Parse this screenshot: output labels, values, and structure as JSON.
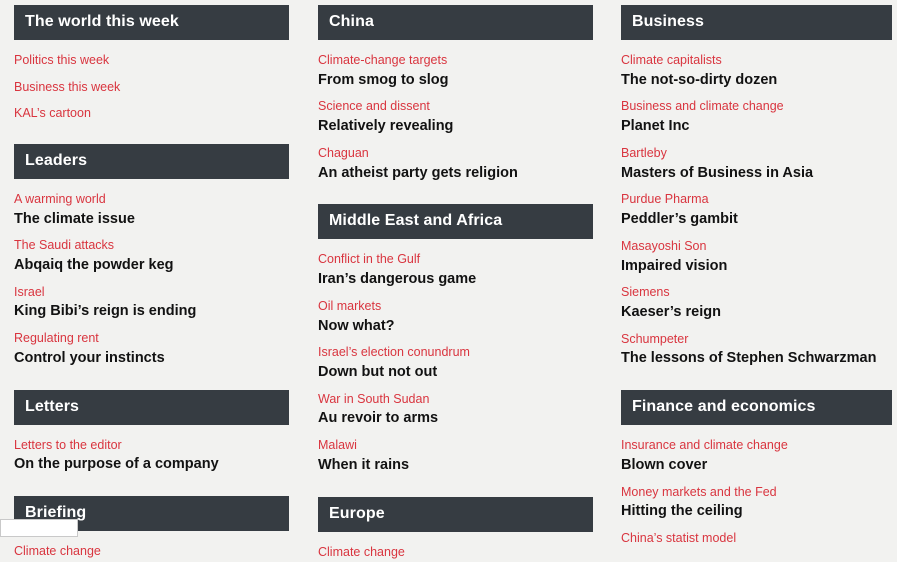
{
  "page": {
    "background_color": "#f2f2f0",
    "header_bar_color": "#363c42",
    "flytitle_color": "#d9353f",
    "headline_color": "#121212"
  },
  "columns": [
    {
      "name": "column-left",
      "sections": [
        {
          "title": "The world this week",
          "style": "links-only",
          "articles": [
            {
              "flytitle": "Politics this week",
              "headline": ""
            },
            {
              "flytitle": "Business this week",
              "headline": ""
            },
            {
              "flytitle": "KAL’s cartoon",
              "headline": ""
            }
          ]
        },
        {
          "title": "Leaders",
          "style": "fly-and-headline",
          "articles": [
            {
              "flytitle": "A warming world",
              "headline": "The climate issue"
            },
            {
              "flytitle": "The Saudi attacks",
              "headline": "Abqaiq the powder keg"
            },
            {
              "flytitle": "Israel",
              "headline": "King Bibi’s reign is ending"
            },
            {
              "flytitle": "Regulating rent",
              "headline": "Control your instincts"
            }
          ]
        },
        {
          "title": "Letters",
          "style": "fly-and-headline",
          "articles": [
            {
              "flytitle": "Letters to the editor",
              "headline": "On the purpose of a company"
            }
          ]
        },
        {
          "title": "Briefing",
          "style": "fly-and-headline",
          "articles": [
            {
              "flytitle": "Climate change",
              "headline": ""
            }
          ]
        }
      ]
    },
    {
      "name": "column-middle",
      "sections": [
        {
          "title": "China",
          "style": "fly-and-headline",
          "articles": [
            {
              "flytitle": "Climate-change targets",
              "headline": "From smog to slog"
            },
            {
              "flytitle": "Science and dissent",
              "headline": "Relatively revealing"
            },
            {
              "flytitle": "Chaguan",
              "headline": "An atheist party gets religion"
            }
          ]
        },
        {
          "title": "Middle East and Africa",
          "style": "fly-and-headline",
          "articles": [
            {
              "flytitle": "Conflict in the Gulf",
              "headline": "Iran’s dangerous game"
            },
            {
              "flytitle": "Oil markets",
              "headline": "Now what?"
            },
            {
              "flytitle": "Israel’s election conundrum",
              "headline": "Down but not out"
            },
            {
              "flytitle": "War in South Sudan",
              "headline": "Au revoir to arms"
            },
            {
              "flytitle": "Malawi",
              "headline": "When it rains"
            }
          ]
        },
        {
          "title": "Europe",
          "style": "fly-and-headline",
          "articles": [
            {
              "flytitle": "Climate change",
              "headline": ""
            }
          ]
        }
      ]
    },
    {
      "name": "column-right",
      "sections": [
        {
          "title": "Business",
          "style": "fly-and-headline",
          "articles": [
            {
              "flytitle": "Climate capitalists",
              "headline": "The not-so-dirty dozen"
            },
            {
              "flytitle": "Business and climate change",
              "headline": "Planet Inc"
            },
            {
              "flytitle": "Bartleby",
              "headline": "Masters of Business in Asia"
            },
            {
              "flytitle": "Purdue Pharma",
              "headline": "Peddler’s gambit"
            },
            {
              "flytitle": "Masayoshi Son",
              "headline": "Impaired vision"
            },
            {
              "flytitle": "Siemens",
              "headline": "Kaeser’s reign"
            },
            {
              "flytitle": "Schumpeter",
              "headline": "The lessons of Stephen Schwarzman"
            }
          ]
        },
        {
          "title": "Finance and economics",
          "style": "fly-and-headline",
          "articles": [
            {
              "flytitle": "Insurance and climate change",
              "headline": "Blown cover"
            },
            {
              "flytitle": "Money markets and the Fed",
              "headline": "Hitting the ceiling"
            },
            {
              "flytitle": "China’s statist model",
              "headline": ""
            }
          ]
        }
      ]
    }
  ]
}
